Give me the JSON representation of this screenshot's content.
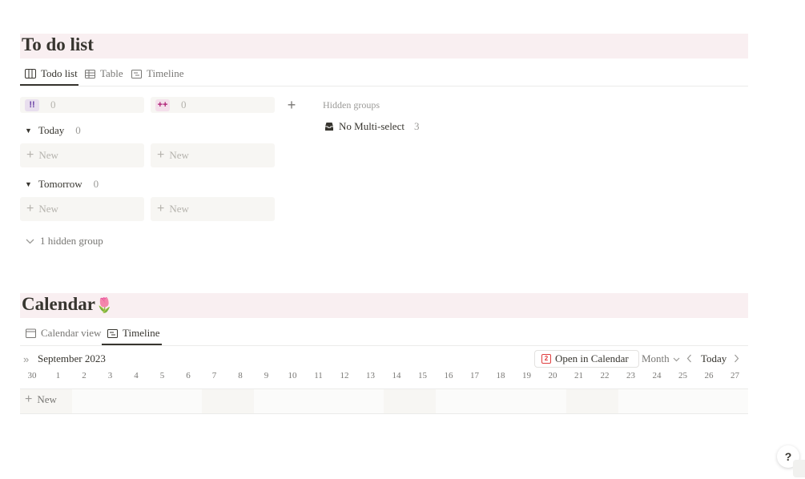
{
  "todo": {
    "title": "To do list",
    "tabs": [
      {
        "label": "Todo list",
        "icon": "board-icon"
      },
      {
        "label": "Table",
        "icon": "table-icon"
      },
      {
        "label": "Timeline",
        "icon": "timeline-icon"
      }
    ],
    "columns": [
      {
        "tag": "!!",
        "count": "0",
        "tag_bg": "#e8deee",
        "tag_fg": "#6940a5"
      },
      {
        "tag": "++",
        "count": "0",
        "tag_bg": "#f4dfeb",
        "tag_fg": "#ad1a72"
      }
    ],
    "hidden_groups_label": "Hidden groups",
    "hidden_group_item": {
      "label": "No Multi-select",
      "count": "3"
    },
    "groups": [
      {
        "label": "Today",
        "count": "0",
        "new_label": "New"
      },
      {
        "label": "Tomorrow",
        "count": "0",
        "new_label": "New"
      }
    ],
    "hidden_toggle": "1 hidden group"
  },
  "calendar": {
    "title": "Calendar",
    "title_emoji": "🌷",
    "tabs": [
      {
        "label": "Calendar view",
        "icon": "calendar-icon"
      },
      {
        "label": "Timeline",
        "icon": "timeline-icon"
      }
    ],
    "month_label": "September 2023",
    "open_in_calendar": "Open in Calendar",
    "open_icon_day": "2",
    "range_select": "Month",
    "today_button": "Today",
    "days": [
      "30",
      "1",
      "2",
      "3",
      "4",
      "5",
      "6",
      "7",
      "8",
      "9",
      "10",
      "11",
      "12",
      "13",
      "14",
      "15",
      "16",
      "17",
      "18",
      "19",
      "20",
      "21",
      "22",
      "23",
      "24",
      "25",
      "26",
      "27"
    ],
    "new_label": "New"
  },
  "help_label": "?",
  "colors": {
    "banner": "#f9eff1",
    "accent_red": "#e03e3e"
  }
}
